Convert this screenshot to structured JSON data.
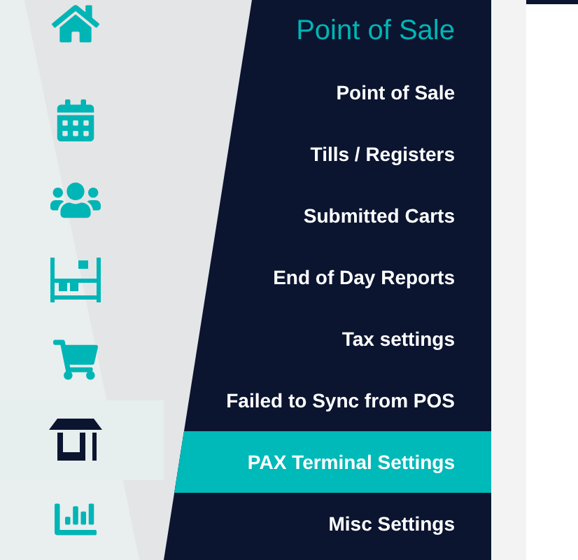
{
  "rail": [
    {
      "kind": "home",
      "selected": false
    },
    {
      "kind": "calendar",
      "selected": false
    },
    {
      "kind": "users",
      "selected": false
    },
    {
      "kind": "pallet",
      "selected": false
    },
    {
      "kind": "cart",
      "selected": false
    },
    {
      "kind": "store",
      "selected": true
    },
    {
      "kind": "chart",
      "selected": false
    }
  ],
  "menu": {
    "title": "Point of Sale",
    "items": [
      {
        "label": "Point of Sale",
        "selected": false
      },
      {
        "label": "Tills / Registers",
        "selected": false
      },
      {
        "label": "Submitted Carts",
        "selected": false
      },
      {
        "label": "End of Day Reports",
        "selected": false
      },
      {
        "label": "Tax settings",
        "selected": false
      },
      {
        "label": "Failed to Sync from POS",
        "selected": false
      },
      {
        "label": "PAX Terminal Settings",
        "selected": true
      },
      {
        "label": "Misc Settings",
        "selected": false
      }
    ]
  }
}
